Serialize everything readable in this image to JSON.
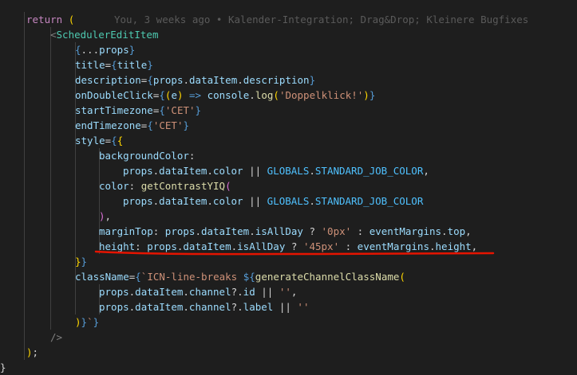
{
  "blame_annotation": "You, 3 weeks ago • Kalender-Integration; Drag&Drop; Kleinere Bugfixes",
  "colors": {
    "background": "#1e1e1e",
    "underline": "#e51400"
  },
  "code_lines": [
    [
      {
        "t": "return",
        "c": "t-kw"
      },
      {
        "t": " ",
        "c": "t-p"
      },
      {
        "t": "(",
        "c": "t-b1"
      }
    ],
    [
      {
        "t": "<",
        "c": "t-tagp"
      },
      {
        "t": "SchedulerEditItem",
        "c": "t-tag"
      }
    ],
    [
      {
        "t": "{",
        "c": "t-arrow"
      },
      {
        "t": "...",
        "c": "t-p"
      },
      {
        "t": "props",
        "c": "t-var"
      },
      {
        "t": "}",
        "c": "t-arrow"
      }
    ],
    [
      {
        "t": "title",
        "c": "t-attr"
      },
      {
        "t": "=",
        "c": "t-p"
      },
      {
        "t": "{",
        "c": "t-arrow"
      },
      {
        "t": "title",
        "c": "t-var"
      },
      {
        "t": "}",
        "c": "t-arrow"
      }
    ],
    [
      {
        "t": "description",
        "c": "t-attr"
      },
      {
        "t": "=",
        "c": "t-p"
      },
      {
        "t": "{",
        "c": "t-arrow"
      },
      {
        "t": "props",
        "c": "t-var"
      },
      {
        "t": ".",
        "c": "t-p"
      },
      {
        "t": "dataItem",
        "c": "t-var"
      },
      {
        "t": ".",
        "c": "t-p"
      },
      {
        "t": "description",
        "c": "t-var"
      },
      {
        "t": "}",
        "c": "t-arrow"
      }
    ],
    [
      {
        "t": "onDoubleClick",
        "c": "t-attr"
      },
      {
        "t": "=",
        "c": "t-p"
      },
      {
        "t": "{",
        "c": "t-arrow"
      },
      {
        "t": "(",
        "c": "t-b1"
      },
      {
        "t": "e",
        "c": "t-var"
      },
      {
        "t": ")",
        "c": "t-b1"
      },
      {
        "t": " => ",
        "c": "t-arrow"
      },
      {
        "t": "console",
        "c": "t-var"
      },
      {
        "t": ".",
        "c": "t-p"
      },
      {
        "t": "log",
        "c": "t-fn"
      },
      {
        "t": "(",
        "c": "t-b1"
      },
      {
        "t": "'Doppelklick!'",
        "c": "t-str"
      },
      {
        "t": ")",
        "c": "t-b1"
      },
      {
        "t": "}",
        "c": "t-arrow"
      }
    ],
    [
      {
        "t": "startTimezone",
        "c": "t-attr"
      },
      {
        "t": "=",
        "c": "t-p"
      },
      {
        "t": "{",
        "c": "t-arrow"
      },
      {
        "t": "'CET'",
        "c": "t-str"
      },
      {
        "t": "}",
        "c": "t-arrow"
      }
    ],
    [
      {
        "t": "endTimezone",
        "c": "t-attr"
      },
      {
        "t": "=",
        "c": "t-p"
      },
      {
        "t": "{",
        "c": "t-arrow"
      },
      {
        "t": "'CET'",
        "c": "t-str"
      },
      {
        "t": "}",
        "c": "t-arrow"
      }
    ],
    [
      {
        "t": "style",
        "c": "t-attr"
      },
      {
        "t": "=",
        "c": "t-p"
      },
      {
        "t": "{",
        "c": "t-arrow"
      },
      {
        "t": "{",
        "c": "t-b1"
      }
    ],
    [
      {
        "t": "backgroundColor",
        "c": "t-var"
      },
      {
        "t": ":",
        "c": "t-p"
      }
    ],
    [
      {
        "t": "props",
        "c": "t-var"
      },
      {
        "t": ".",
        "c": "t-p"
      },
      {
        "t": "dataItem",
        "c": "t-var"
      },
      {
        "t": ".",
        "c": "t-p"
      },
      {
        "t": "color",
        "c": "t-var"
      },
      {
        "t": " || ",
        "c": "t-p"
      },
      {
        "t": "GLOBALS",
        "c": "t-const"
      },
      {
        "t": ".",
        "c": "t-p"
      },
      {
        "t": "STANDARD_JOB_COLOR",
        "c": "t-const"
      },
      {
        "t": ",",
        "c": "t-p"
      }
    ],
    [
      {
        "t": "color",
        "c": "t-var"
      },
      {
        "t": ": ",
        "c": "t-p"
      },
      {
        "t": "getContrastYIQ",
        "c": "t-fn"
      },
      {
        "t": "(",
        "c": "t-b2"
      }
    ],
    [
      {
        "t": "props",
        "c": "t-var"
      },
      {
        "t": ".",
        "c": "t-p"
      },
      {
        "t": "dataItem",
        "c": "t-var"
      },
      {
        "t": ".",
        "c": "t-p"
      },
      {
        "t": "color",
        "c": "t-var"
      },
      {
        "t": " || ",
        "c": "t-p"
      },
      {
        "t": "GLOBALS",
        "c": "t-const"
      },
      {
        "t": ".",
        "c": "t-p"
      },
      {
        "t": "STANDARD_JOB_COLOR",
        "c": "t-const"
      }
    ],
    [
      {
        "t": ")",
        "c": "t-b2"
      },
      {
        "t": ",",
        "c": "t-p"
      }
    ],
    [
      {
        "t": "marginTop",
        "c": "t-var"
      },
      {
        "t": ": ",
        "c": "t-p"
      },
      {
        "t": "props",
        "c": "t-var"
      },
      {
        "t": ".",
        "c": "t-p"
      },
      {
        "t": "dataItem",
        "c": "t-var"
      },
      {
        "t": ".",
        "c": "t-p"
      },
      {
        "t": "isAllDay",
        "c": "t-var"
      },
      {
        "t": " ? ",
        "c": "t-p"
      },
      {
        "t": "'0px'",
        "c": "t-str"
      },
      {
        "t": " : ",
        "c": "t-p"
      },
      {
        "t": "eventMargins",
        "c": "t-var"
      },
      {
        "t": ".",
        "c": "t-p"
      },
      {
        "t": "top",
        "c": "t-var"
      },
      {
        "t": ",",
        "c": "t-p"
      }
    ],
    [
      {
        "t": "height",
        "c": "t-var"
      },
      {
        "t": ": ",
        "c": "t-p"
      },
      {
        "t": "props",
        "c": "t-var"
      },
      {
        "t": ".",
        "c": "t-p"
      },
      {
        "t": "dataItem",
        "c": "t-var"
      },
      {
        "t": ".",
        "c": "t-p"
      },
      {
        "t": "isAllDay",
        "c": "t-var"
      },
      {
        "t": " ? ",
        "c": "t-p"
      },
      {
        "t": "'45px'",
        "c": "t-str"
      },
      {
        "t": " : ",
        "c": "t-p"
      },
      {
        "t": "eventMargins",
        "c": "t-var"
      },
      {
        "t": ".",
        "c": "t-p"
      },
      {
        "t": "height",
        "c": "t-var"
      },
      {
        "t": ",",
        "c": "t-p"
      }
    ],
    [
      {
        "t": "}",
        "c": "t-b1"
      },
      {
        "t": "}",
        "c": "t-arrow"
      }
    ],
    [
      {
        "t": "className",
        "c": "t-attr"
      },
      {
        "t": "=",
        "c": "t-p"
      },
      {
        "t": "{",
        "c": "t-arrow"
      },
      {
        "t": "`ICN-line-breaks ",
        "c": "t-tpl"
      },
      {
        "t": "${",
        "c": "t-tpli"
      },
      {
        "t": "generateChannelClassName",
        "c": "t-fn"
      },
      {
        "t": "(",
        "c": "t-b1"
      }
    ],
    [
      {
        "t": "props",
        "c": "t-var"
      },
      {
        "t": ".",
        "c": "t-p"
      },
      {
        "t": "dataItem",
        "c": "t-var"
      },
      {
        "t": ".",
        "c": "t-p"
      },
      {
        "t": "channel",
        "c": "t-var"
      },
      {
        "t": "?.",
        "c": "t-p"
      },
      {
        "t": "id",
        "c": "t-var"
      },
      {
        "t": " || ",
        "c": "t-p"
      },
      {
        "t": "''",
        "c": "t-str"
      },
      {
        "t": ",",
        "c": "t-p"
      }
    ],
    [
      {
        "t": "props",
        "c": "t-var"
      },
      {
        "t": ".",
        "c": "t-p"
      },
      {
        "t": "dataItem",
        "c": "t-var"
      },
      {
        "t": ".",
        "c": "t-p"
      },
      {
        "t": "channel",
        "c": "t-var"
      },
      {
        "t": "?.",
        "c": "t-p"
      },
      {
        "t": "label",
        "c": "t-var"
      },
      {
        "t": " || ",
        "c": "t-p"
      },
      {
        "t": "''",
        "c": "t-str"
      }
    ],
    [
      {
        "t": ")",
        "c": "t-b1"
      },
      {
        "t": "}",
        "c": "t-tpli"
      },
      {
        "t": "`",
        "c": "t-tpl"
      },
      {
        "t": "}",
        "c": "t-arrow"
      }
    ],
    [
      {
        "t": "/>",
        "c": "t-tagp"
      }
    ],
    [
      {
        "t": ")",
        "c": "t-b1"
      },
      {
        "t": ";",
        "c": "t-p"
      }
    ],
    [
      {
        "t": "}",
        "c": "t-p"
      }
    ]
  ]
}
